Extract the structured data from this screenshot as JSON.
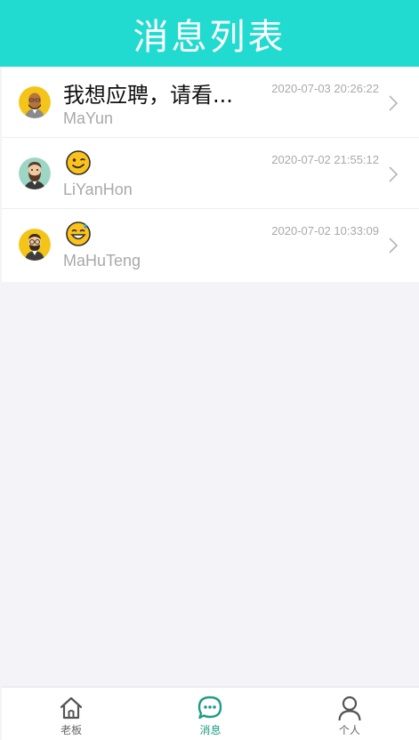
{
  "header": {
    "title": "消息列表"
  },
  "conversations": [
    {
      "message": "我想应聘，请看...",
      "name": "MaYun",
      "time": "2020-07-03 20:26:22",
      "avatar": "avatar-bald-man-icon"
    },
    {
      "message": "",
      "emoji": "winking-face-icon",
      "name": "LiYanHon",
      "time": "2020-07-02 21:55:12",
      "avatar": "avatar-bearded-man-icon"
    },
    {
      "message": "",
      "emoji": "grinning-sweat-face-icon",
      "name": "MaHuTeng",
      "time": "2020-07-02 10:33:09",
      "avatar": "avatar-glasses-man-icon"
    }
  ],
  "tabbar": {
    "tabs": [
      {
        "label": "老板",
        "icon": "home-icon",
        "active": false
      },
      {
        "label": "消息",
        "icon": "chat-bubble-icon",
        "active": true
      },
      {
        "label": "个人",
        "icon": "person-icon",
        "active": false
      }
    ]
  },
  "colors": {
    "header": "#21dbd0",
    "active_tab": "#1f9c86",
    "background": "#f3f3f8"
  }
}
